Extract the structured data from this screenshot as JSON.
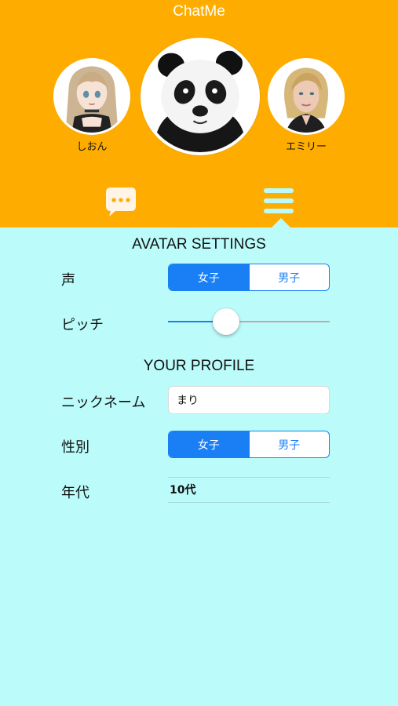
{
  "app": {
    "title": "ChatMe"
  },
  "avatars": [
    {
      "name": "しおん",
      "icon": "anime-girl-avatar"
    },
    {
      "name": "",
      "icon": "panda-avatar",
      "selected": true
    },
    {
      "name": "エミリー",
      "icon": "woman-avatar"
    }
  ],
  "tabs": [
    {
      "icon": "chat-bubble-icon",
      "selected": false
    },
    {
      "icon": "menu-icon",
      "selected": true
    }
  ],
  "avatar_settings": {
    "title": "AVATAR SETTINGS",
    "voice": {
      "label": "声",
      "options": [
        "女子",
        "男子"
      ],
      "selected": "女子"
    },
    "pitch": {
      "label": "ピッチ",
      "value": 0.36
    }
  },
  "profile": {
    "title": "YOUR PROFILE",
    "nickname": {
      "label": "ニックネーム",
      "value": "まり",
      "placeholder": ""
    },
    "gender": {
      "label": "性別",
      "options": [
        "女子",
        "男子"
      ],
      "selected": "女子"
    },
    "age": {
      "label": "年代",
      "value": "10代"
    }
  },
  "colors": {
    "header": "#fead00",
    "background": "#bbfcfb",
    "accent": "#1a7ff5",
    "tab_icon": "#fff4e5"
  }
}
